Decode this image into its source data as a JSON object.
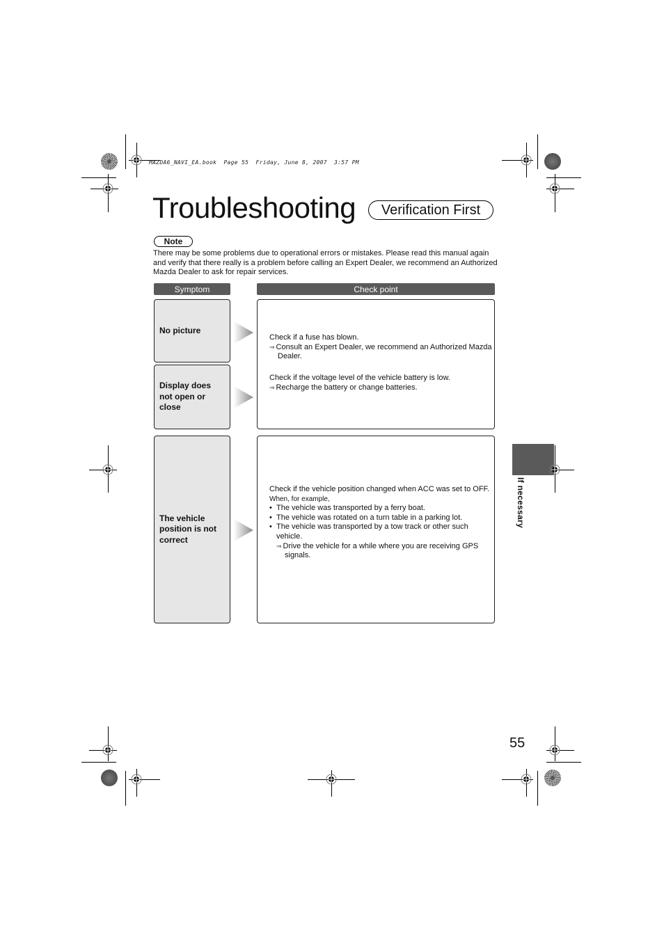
{
  "print_header": "MAZDA6_NAVI_EA.book  Page 55  Friday, June 8, 2007  3:57 PM",
  "title": "Troubleshooting",
  "subtitle": "Verification First",
  "note": {
    "label": "Note",
    "text": "There may be some problems due to operational errors or mistakes. Please read this manual again and verify that there really is a problem before calling an Expert Dealer, we recommend an Authorized Mazda Dealer to ask for repair services."
  },
  "table": {
    "headers": {
      "symptom": "Symptom",
      "check_point": "Check point"
    },
    "groups": [
      {
        "symptoms": [
          "No picture",
          "Display does not open or close"
        ],
        "checks": [
          {
            "text": "Check if a fuse has blown.",
            "action": "Consult an Expert Dealer, we recommend an Authorized Mazda Dealer."
          },
          {
            "text": "Check if the voltage level of the vehicle battery is low.",
            "action": "Recharge the battery or change batteries."
          }
        ]
      },
      {
        "symptoms": [
          "The vehicle position is not correct"
        ],
        "checks": [
          {
            "text": "Check if the vehicle position changed when ACC was set to OFF.",
            "example_intro": "When, for example,",
            "bullets": [
              "The vehicle was transported by a ferry boat.",
              "The vehicle was rotated on a turn table in a parking lot.",
              "The vehicle was transported by a tow track or other such vehicle."
            ],
            "action": "Drive the vehicle for a while where you are receiving GPS signals."
          }
        ]
      }
    ]
  },
  "icons": {
    "arrow": "arrow-right-icon",
    "action_arrow": "⇒",
    "bullet": "•"
  },
  "side_tab": {
    "label": "If necessary",
    "color": "#5a5a5a"
  },
  "page_number": "55"
}
